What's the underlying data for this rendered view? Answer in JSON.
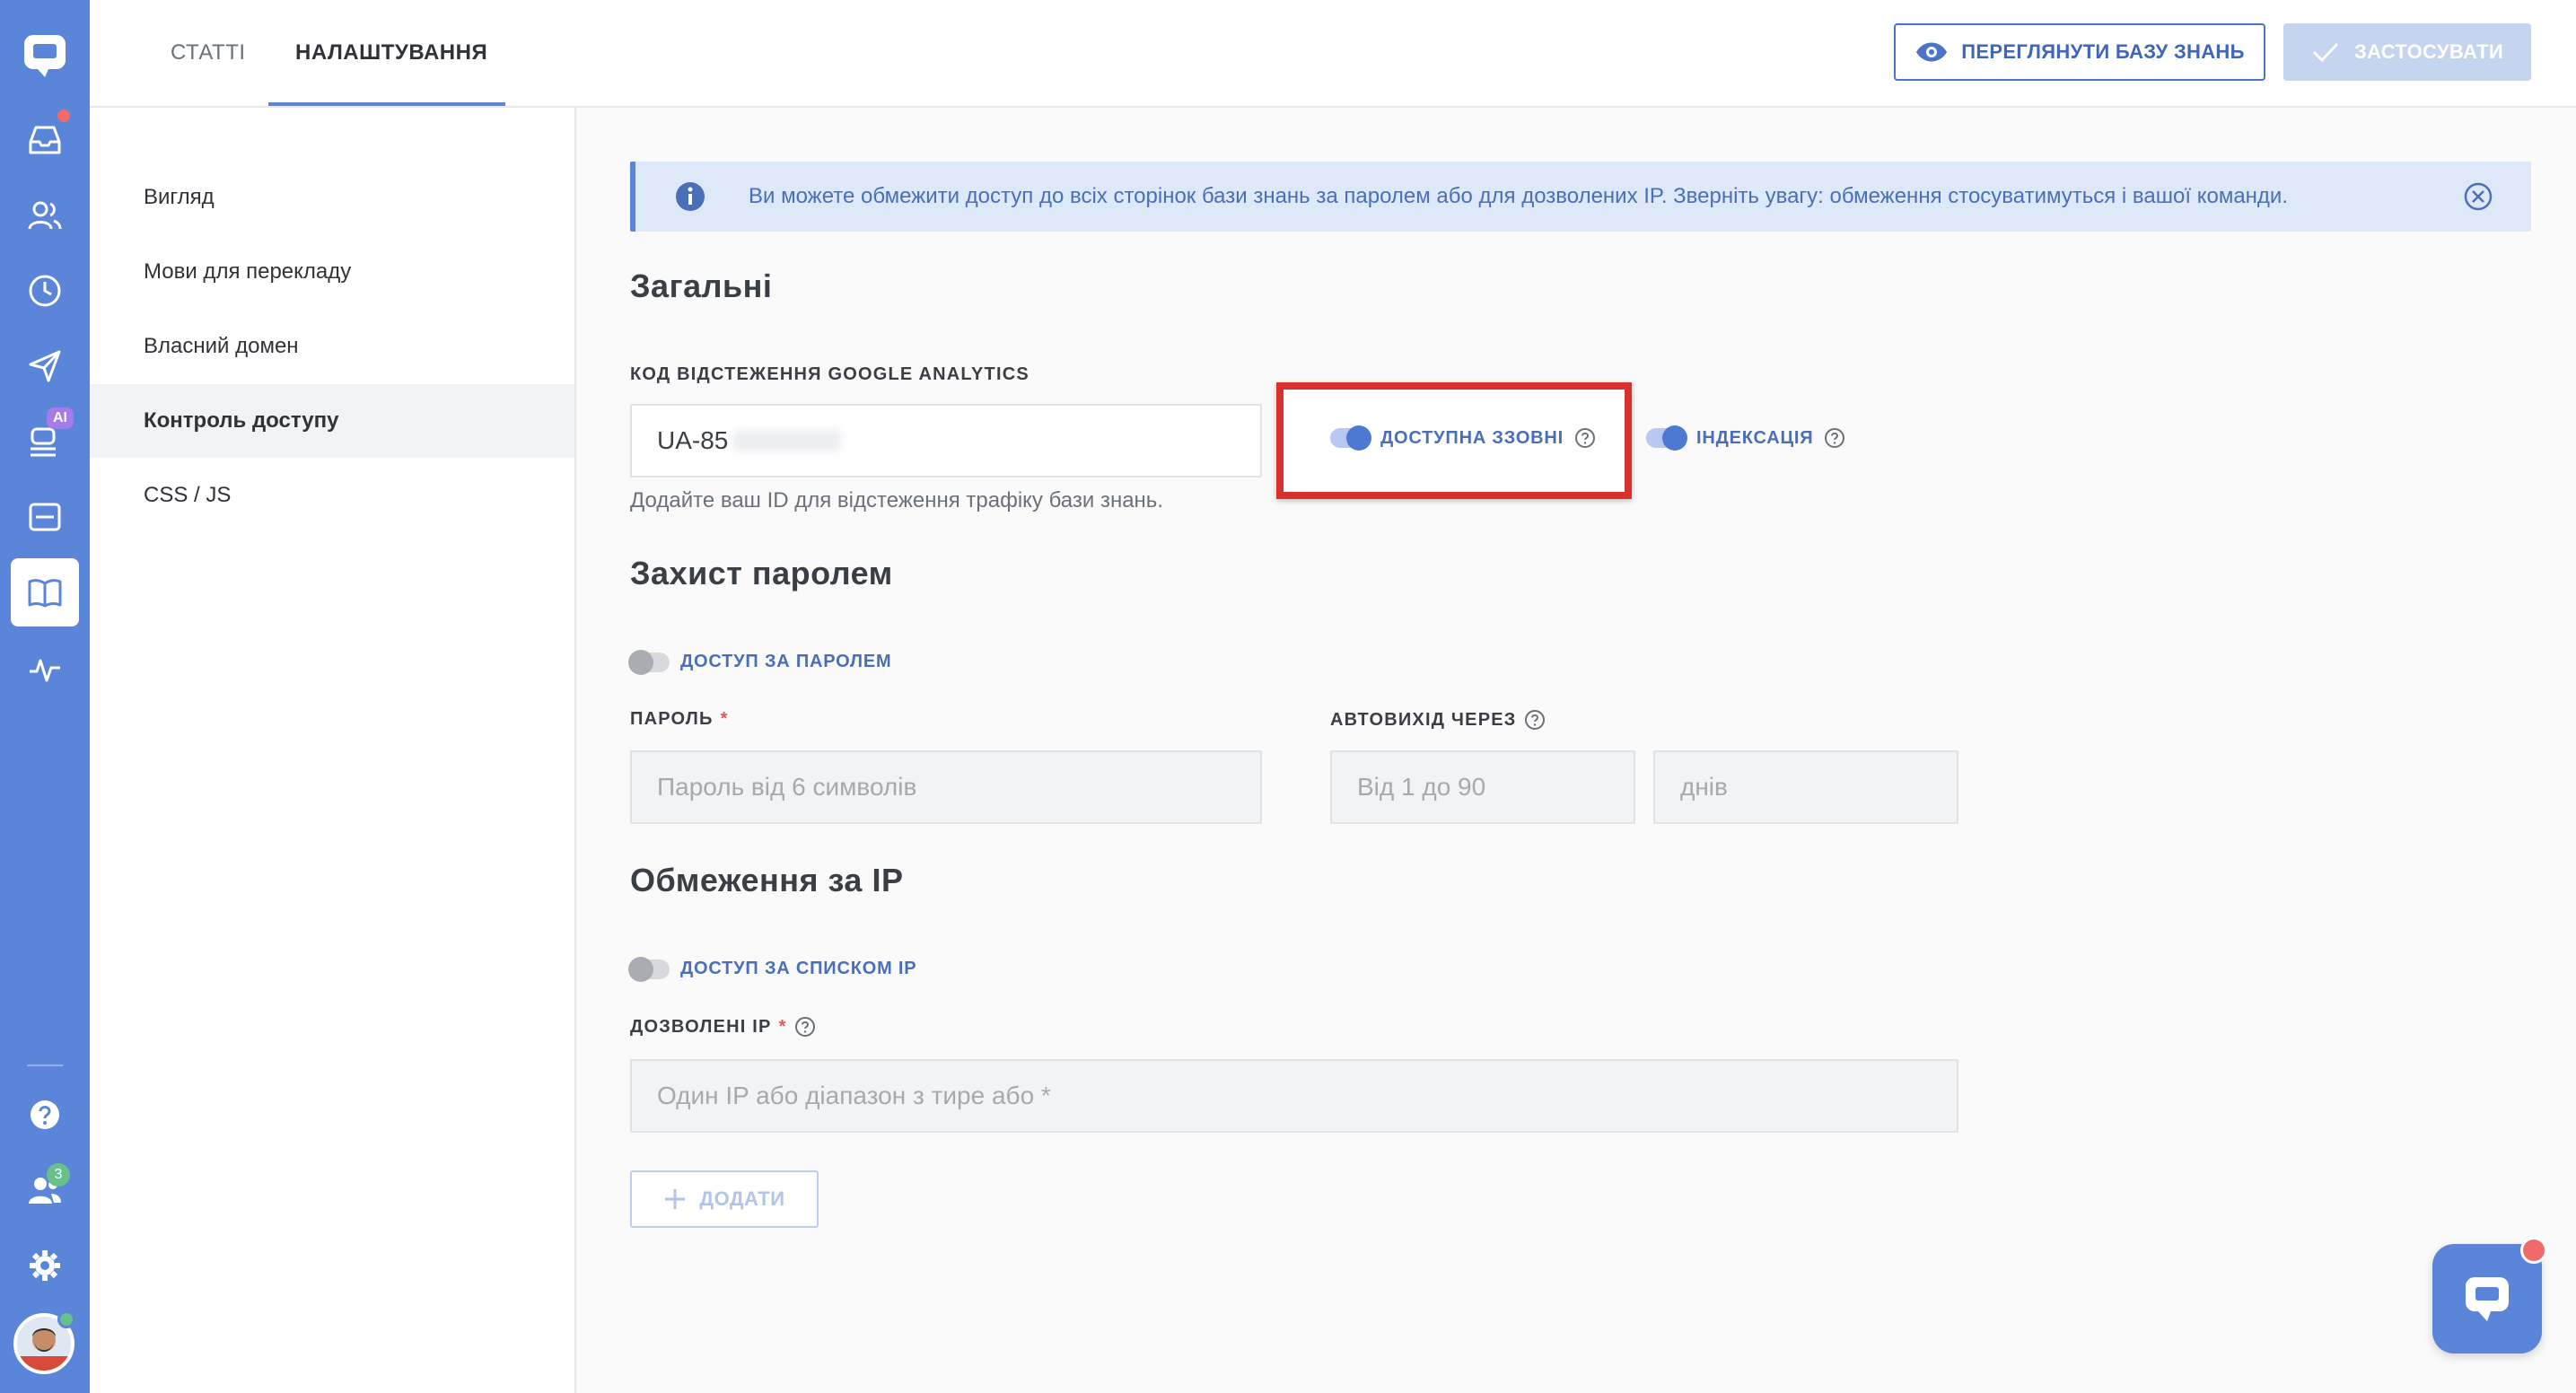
{
  "tabs": {
    "articles": "СТАТТІ",
    "settings": "НАЛАШТУВАННЯ"
  },
  "toolbar": {
    "view_kb": "ПЕРЕГЛЯНУТИ БАЗУ ЗНАНЬ",
    "apply": "ЗАСТОСУВАТИ"
  },
  "sidebar": {
    "items": [
      {
        "label": "Вигляд"
      },
      {
        "label": "Мови для перекладу"
      },
      {
        "label": "Власний домен"
      },
      {
        "label": "Контроль доступу"
      },
      {
        "label": "CSS / JS"
      }
    ]
  },
  "rail": {
    "ai_badge": "AI",
    "team_badge": "3"
  },
  "info": {
    "text": "Ви можете обмежити доступ до всіх сторінок бази знань за паролем або для дозволених IP. Зверніть увагу: обмеження стосуватимуться і вашої команди."
  },
  "general": {
    "title": "Загальні",
    "ga_label": "КОД ВІДСТЕЖЕННЯ GOOGLE ANALYTICS",
    "ga_value": "UA-85",
    "ga_help": "Додайте ваш ID для відстеження трафіку бази знань.",
    "public_label": "ДОСТУПНА ЗЗОВНІ",
    "indexing_label": "ІНДЕКСАЦІЯ"
  },
  "password": {
    "title": "Захист паролем",
    "toggle_label": "ДОСТУП ЗА ПАРОЛЕМ",
    "field_label": "ПАРОЛЬ",
    "required": "*",
    "placeholder": "Пароль від 6 символів",
    "logout_label": "АВТОВИХІД ЧЕРЕЗ",
    "logout_placeholder": "Від 1 до 90",
    "days": "днів"
  },
  "ip": {
    "title": "Обмеження за IP",
    "toggle_label": "ДОСТУП ЗА СПИСКОМ IP",
    "field_label": "ДОЗВОЛЕНІ IP",
    "required": "*",
    "placeholder": "Один IP або діапазон з тире або *",
    "add": "ДОДАТИ"
  },
  "colors": {
    "accent": "#5b85d8",
    "highlight": "#d9302c"
  }
}
